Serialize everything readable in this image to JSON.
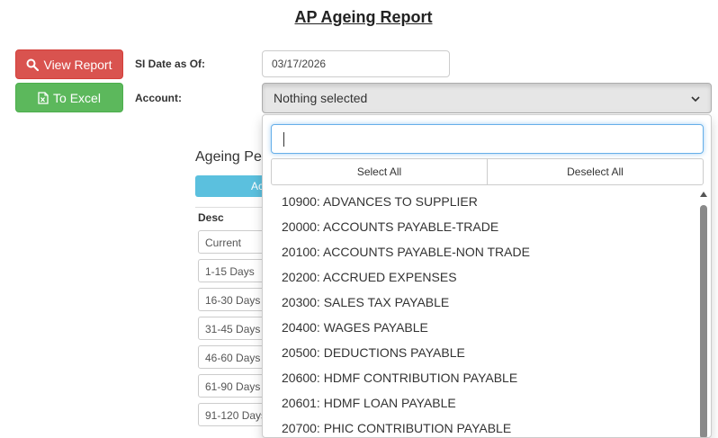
{
  "page": {
    "title": "AP Ageing Report"
  },
  "toolbar": {
    "view_report": "View Report",
    "to_excel": "To Excel"
  },
  "form": {
    "date_label": "SI Date as Of:",
    "date_value": "03/17/2026",
    "account_label": "Account:",
    "account_value": "Nothing selected"
  },
  "ageing": {
    "title": "Ageing Pe",
    "button_label": "Ac",
    "column_header": "Desc",
    "rows": [
      "Current",
      "1-15 Days",
      "16-30 Days",
      "31-45 Days",
      "46-60 Days",
      "61-90 Days",
      "91-120 Days"
    ]
  },
  "dropdown": {
    "search_value": "",
    "select_all": "Select All",
    "deselect_all": "Deselect All",
    "options": [
      "10900: ADVANCES TO SUPPLIER",
      "20000: ACCOUNTS PAYABLE-TRADE",
      "20100: ACCOUNTS PAYABLE-NON TRADE",
      "20200: ACCRUED EXPENSES",
      "20300: SALES TAX PAYABLE",
      "20400: WAGES PAYABLE",
      "20500: DEDUCTIONS PAYABLE",
      "20600: HDMF CONTRIBUTION PAYABLE",
      "20601: HDMF LOAN PAYABLE",
      "20700: PHIC CONTRIBUTION PAYABLE"
    ]
  },
  "colors": {
    "danger": "#d9534f",
    "success": "#5cb85c",
    "info": "#5bc0de",
    "focus": "#66afe9"
  },
  "icons": {
    "view_report": "search-icon",
    "to_excel": "excel-file-icon",
    "select": "chevron-down-icon"
  }
}
